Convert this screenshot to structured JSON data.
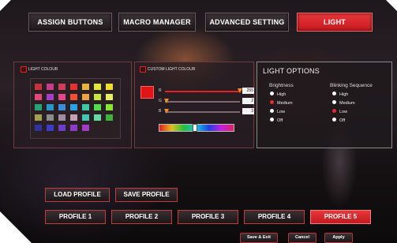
{
  "tabs": [
    {
      "label": "ASSIGN BUTTONS",
      "active": false
    },
    {
      "label": "MACRO MANAGER",
      "active": false
    },
    {
      "label": "ADVANCED SETTING",
      "active": false
    },
    {
      "label": "LIGHT",
      "active": true
    }
  ],
  "light_colour": {
    "label": "LIGHT COLOUR",
    "swatches": [
      [
        "#c8323c",
        "#c83c8c",
        "#d23c5a",
        "#e63232",
        "#e6b43c",
        "#e6e63c",
        "#f0dc28"
      ],
      [
        "#e64678",
        "#aa3cc8",
        "#e6468c",
        "#f05032",
        "#f0a03c",
        "#c8e640",
        "#e6f05a"
      ],
      [
        "#28a078",
        "#2896c8",
        "#3c8cdc",
        "#28a0e6",
        "#3cc8a0",
        "#50dc50",
        "#82e632"
      ],
      [
        "#a0a050",
        "#8c8c8c",
        "#a08ca0",
        "#c8a0b4",
        "#3cc8b4",
        "#64dca0",
        "#3cb43c"
      ],
      [
        "#3232a0",
        "#3c3cc8",
        "#6e3cc8",
        "#8c3cc8",
        "#a03cc8",
        "",
        ""
      ]
    ]
  },
  "custom_light_colour": {
    "label": "CUSTOM LIGHT COLOUR",
    "current_color": "#e01414",
    "sliders": [
      {
        "letter": "R",
        "value": "255",
        "fraction": 1.0,
        "color": "#e82020"
      },
      {
        "letter": "G",
        "value": "2",
        "fraction": 0.01,
        "color": "#20c040"
      },
      {
        "letter": "B",
        "value": "3",
        "fraction": 0.01,
        "color": "#2060e0"
      }
    ]
  },
  "light_options": {
    "title": "LIGHT OPTIONS",
    "brightness": {
      "heading": "Brightness",
      "options": [
        "High",
        "Medium",
        "Low",
        "Off"
      ],
      "selected": "Medium"
    },
    "blinking": {
      "heading": "Blinking Sequence",
      "options": [
        "High",
        "Medium",
        "Low",
        "Off"
      ],
      "selected": "Low"
    }
  },
  "profile_actions": {
    "load": "LOAD PROFILE",
    "save": "SAVE PROFILE"
  },
  "profiles": [
    {
      "label": "PROFILE 1",
      "active": false
    },
    {
      "label": "PROFILE 2",
      "active": false
    },
    {
      "label": "PROFILE 3",
      "active": false
    },
    {
      "label": "PROFILE 4",
      "active": false
    },
    {
      "label": "PROFILE 5",
      "active": true
    }
  ],
  "footer": {
    "save_exit": "Save & Exit",
    "cancel": "Cancel",
    "apply": "Apply"
  }
}
